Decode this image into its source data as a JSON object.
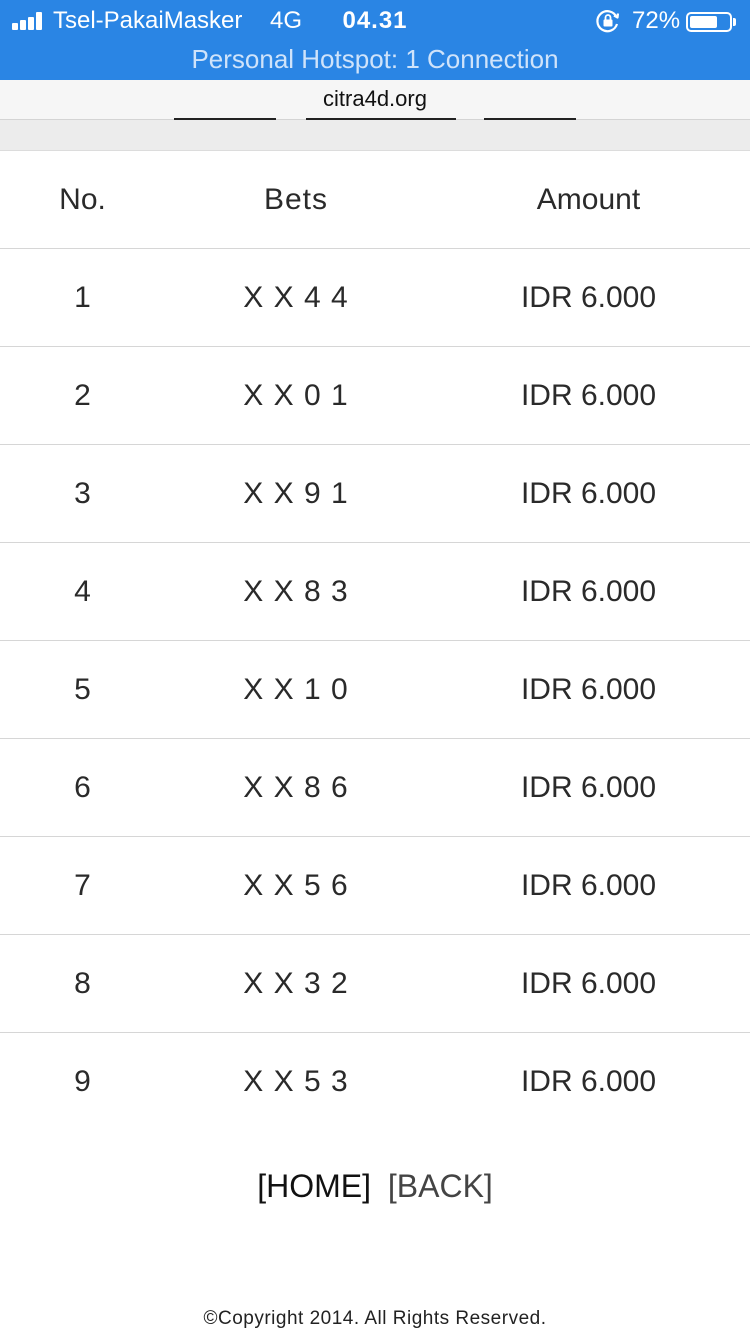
{
  "status_bar": {
    "carrier": "Tsel-PakaiMasker",
    "network": "4G",
    "time": "04.31",
    "battery_percent": "72%",
    "battery_level": 0.72,
    "icons": [
      "signal-bars-icon",
      "orientation-lock-icon",
      "battery-icon"
    ],
    "hotspot_text": "Personal Hotspot: 1 Connection",
    "color": "#2a85e4"
  },
  "browser": {
    "url": "citra4d.org"
  },
  "table": {
    "headers": {
      "no": "No.",
      "bets": "Bets",
      "amount": "Amount"
    },
    "rows": [
      {
        "no": "1",
        "bets": "X X 4 4",
        "amount": "IDR 6.000"
      },
      {
        "no": "2",
        "bets": "X X 0 1",
        "amount": "IDR 6.000"
      },
      {
        "no": "3",
        "bets": "X X 9 1",
        "amount": "IDR 6.000"
      },
      {
        "no": "4",
        "bets": "X X 8 3",
        "amount": "IDR 6.000"
      },
      {
        "no": "5",
        "bets": "X X 1 0",
        "amount": "IDR 6.000"
      },
      {
        "no": "6",
        "bets": "X X 8 6",
        "amount": "IDR 6.000"
      },
      {
        "no": "7",
        "bets": "X X 5 6",
        "amount": "IDR 6.000"
      },
      {
        "no": "8",
        "bets": "X X 3 2",
        "amount": "IDR 6.000"
      },
      {
        "no": "9",
        "bets": "X X 5 3",
        "amount": "IDR 6.000"
      }
    ]
  },
  "nav": {
    "home_label": "[HOME]",
    "back_label": "[BACK]"
  },
  "footer": {
    "copyright": "©Copyright 2014. All Rights Reserved."
  }
}
